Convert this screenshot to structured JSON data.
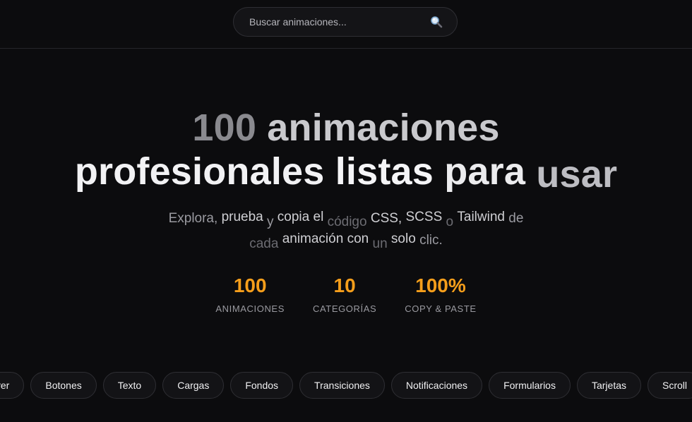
{
  "search": {
    "placeholder": "Buscar animaciones...",
    "icon": "search-icon"
  },
  "hero": {
    "title_words": [
      "100",
      "animaciones",
      "profesionales",
      "listas",
      "para",
      "usar"
    ],
    "subtitle_words": [
      "Explora,",
      "prueba",
      "y",
      "copia",
      "el",
      "código",
      "CSS,",
      "SCSS",
      "o",
      "Tailwind",
      "de",
      "cada",
      "animación",
      "con",
      "un",
      "solo",
      "clic."
    ]
  },
  "stats": [
    {
      "value": "100",
      "label": "ANIMACIONES"
    },
    {
      "value": "10",
      "label": "CATEGORÍAS"
    },
    {
      "value": "100%",
      "label": "COPY & PASTE"
    }
  ],
  "categories": [
    "Hover",
    "Botones",
    "Texto",
    "Cargas",
    "Fondos",
    "Transiciones",
    "Notificaciones",
    "Formularios",
    "Tarjetas",
    "Scroll"
  ],
  "colors": {
    "accent": "#f59e1b",
    "background": "#0c0c0e"
  }
}
